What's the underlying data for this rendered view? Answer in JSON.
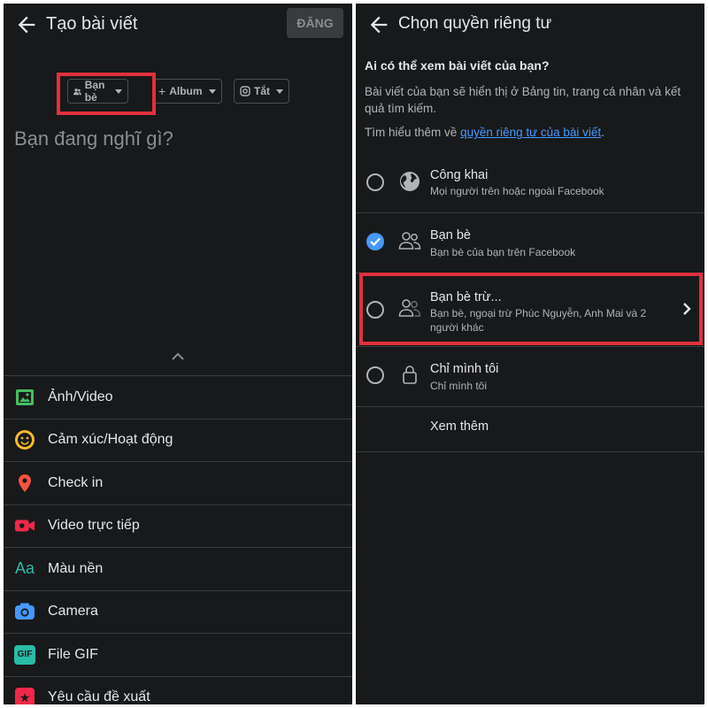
{
  "left": {
    "header": {
      "title": "Tạo bài viết",
      "post_label": "ĐĂNG"
    },
    "audience_chips": [
      {
        "label": "Bạn bè",
        "icon": "friends-icon"
      },
      {
        "label": "Album",
        "icon": "plus-icon"
      },
      {
        "label": "Tắt",
        "icon": "instagram-icon"
      }
    ],
    "composer_placeholder": "Bạn đang nghĩ gì?",
    "menu": [
      {
        "label": "Ảnh/Video",
        "icon": "photo-icon",
        "color": "#45bd62"
      },
      {
        "label": "Cảm xúc/Hoạt động",
        "icon": "smiley-icon",
        "color": "#f7b928"
      },
      {
        "label": "Check in",
        "icon": "location-pin-icon",
        "color": "#f5533d"
      },
      {
        "label": "Video trực tiếp",
        "icon": "live-video-icon",
        "color": "#f02849"
      },
      {
        "label": "Màu nền",
        "icon": "text-style-icon",
        "color": "#2abba7"
      },
      {
        "label": "Camera",
        "icon": "camera-icon",
        "color": "#4599ff"
      },
      {
        "label": "File GIF",
        "icon": "gif-icon",
        "color": "#2abba7"
      },
      {
        "label": "Yêu cầu đề xuất",
        "icon": "recommend-icon",
        "color": "#f02849"
      }
    ]
  },
  "right": {
    "header": {
      "title": "Chọn quyền riêng tư"
    },
    "question": "Ai có thể xem bài viết của bạn?",
    "description": "Bài viết của bạn sẽ hiển thị ở Bảng tin, trang cá nhân và kết quả tìm kiếm.",
    "learn_more_prefix": "Tìm hiểu thêm về",
    "learn_more_link": "quyền riêng tư của bài viết",
    "learn_more_suffix": ".",
    "options": [
      {
        "title": "Công khai",
        "subtitle": "Mọi người trên hoặc ngoài Facebook",
        "icon": "globe-icon",
        "selected": false
      },
      {
        "title": "Bạn bè",
        "subtitle": "Bạn bè của bạn trên Facebook",
        "icon": "friends-icon",
        "selected": true
      },
      {
        "title": "Bạn bè trừ...",
        "subtitle": "Bạn bè, ngoại trừ Phúc Nguyễn, Anh Mai và 2 người khác",
        "icon": "friends-except-icon",
        "selected": false
      },
      {
        "title": "Chỉ mình tôi",
        "subtitle": "Chỉ mình tôi",
        "icon": "lock-icon",
        "selected": false
      }
    ],
    "see_more": "Xem thêm"
  },
  "colors": {
    "background": "#18191a",
    "accent": "#4599ff",
    "highlight": "#e0303e"
  }
}
